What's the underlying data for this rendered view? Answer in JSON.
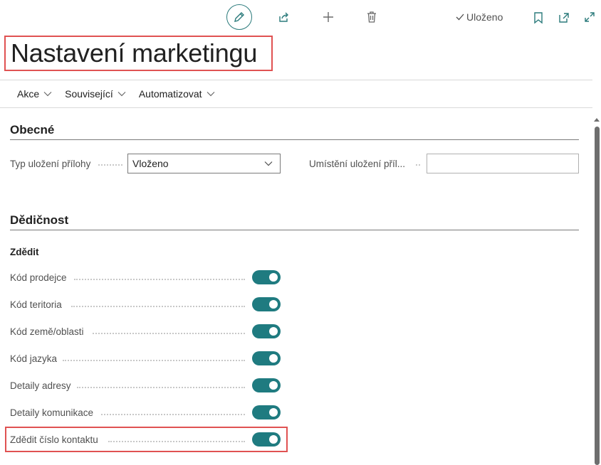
{
  "header": {
    "status_text": "Uloženo",
    "title": "Nastavení marketingu"
  },
  "actions": [
    {
      "label": "Akce"
    },
    {
      "label": "Související"
    },
    {
      "label": "Automatizovat"
    }
  ],
  "sections": {
    "general": {
      "title": "Obecné",
      "attachment_type_label": "Typ uložení přílohy",
      "attachment_type_value": "Vloženo",
      "attachment_location_label": "Umístění uložení příl...",
      "attachment_location_value": ""
    },
    "inheritance": {
      "title": "Dědičnost",
      "subheading": "Zdědit",
      "items": [
        {
          "label": "Kód prodejce",
          "on": true
        },
        {
          "label": "Kód teritoria",
          "on": true
        },
        {
          "label": "Kód země/oblasti",
          "on": true
        },
        {
          "label": "Kód jazyka",
          "on": true
        },
        {
          "label": "Detaily adresy",
          "on": true
        },
        {
          "label": "Detaily komunikace",
          "on": true
        },
        {
          "label": "Zdědit číslo kontaktu",
          "on": true
        }
      ]
    }
  },
  "colors": {
    "accent": "#1f7b80",
    "highlight": "#e05252"
  },
  "icons": [
    "edit-icon",
    "share-icon",
    "add-icon",
    "delete-icon",
    "checkmark-icon",
    "bookmark-icon",
    "open-new-window-icon",
    "expand-icon"
  ]
}
